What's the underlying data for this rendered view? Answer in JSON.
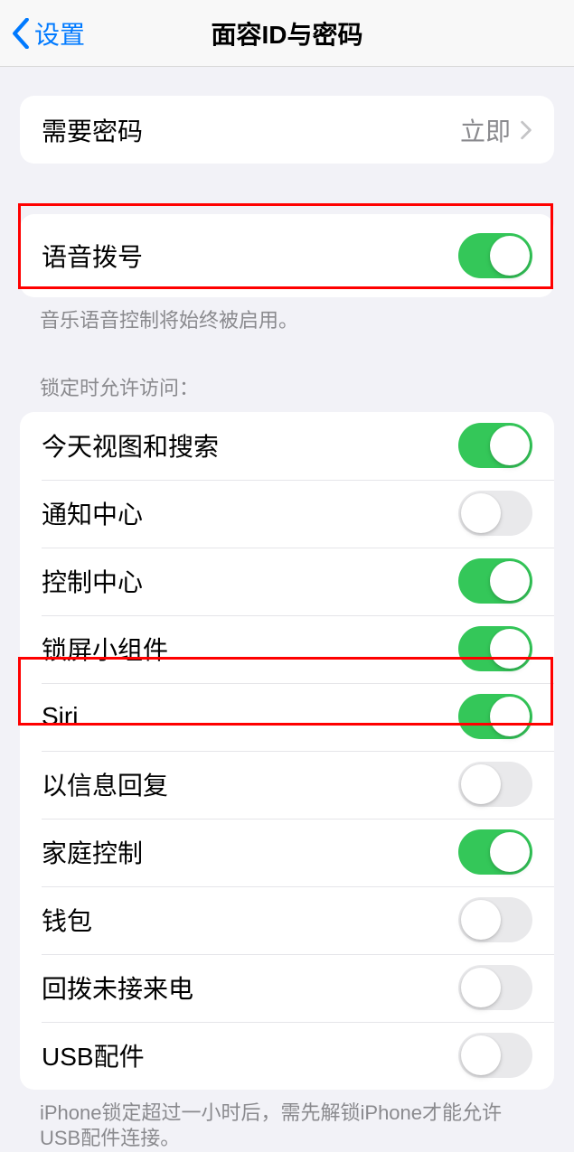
{
  "header": {
    "back_label": "设置",
    "title": "面容ID与密码"
  },
  "require_passcode": {
    "label": "需要密码",
    "value": "立即"
  },
  "voice_dial": {
    "label": "语音拨号",
    "on": true,
    "footer": "音乐语音控制将始终被启用。"
  },
  "allow_access": {
    "header": "锁定时允许访问：",
    "items": [
      {
        "label": "今天视图和搜索",
        "on": true
      },
      {
        "label": "通知中心",
        "on": false
      },
      {
        "label": "控制中心",
        "on": true
      },
      {
        "label": "锁屏小组件",
        "on": true
      },
      {
        "label": "Siri",
        "on": true
      },
      {
        "label": "以信息回复",
        "on": false
      },
      {
        "label": "家庭控制",
        "on": true
      },
      {
        "label": "钱包",
        "on": false
      },
      {
        "label": "回拨未接来电",
        "on": false
      },
      {
        "label": "USB配件",
        "on": false
      }
    ],
    "footer": "iPhone锁定超过一小时后，需先解锁iPhone才能允许USB配件连接。"
  }
}
